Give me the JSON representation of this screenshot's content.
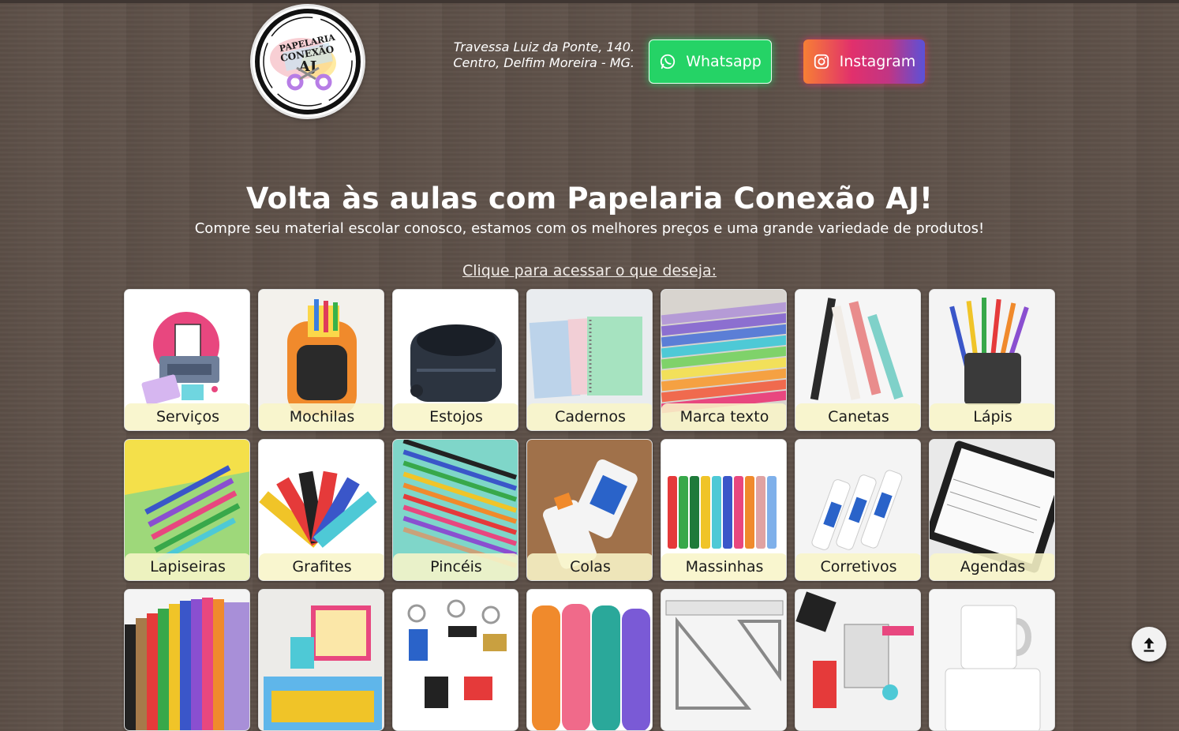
{
  "header": {
    "logo_text": [
      "PAPELARIA",
      "CONEXÃO",
      "AJ"
    ],
    "address_line1": "Travessa Luiz da Ponte, 140.",
    "address_line2": "Centro, Delfim Moreira - MG.",
    "whatsapp_label": "Whatsapp",
    "instagram_label": "Instagram"
  },
  "hero": {
    "title": "Volta às aulas com Papelaria Conexão AJ!",
    "subtitle": "Compre seu material escolar conosco, estamos com os melhores preços e uma grande variedade de produtos!",
    "cta": "Clique para acessar o que deseja:"
  },
  "categories": [
    {
      "label": "Serviços",
      "icon": "printer-icon"
    },
    {
      "label": "Mochilas",
      "icon": "backpack-icon"
    },
    {
      "label": "Estojos",
      "icon": "pencil-case-icon"
    },
    {
      "label": "Cadernos",
      "icon": "notebook-icon"
    },
    {
      "label": "Marca texto",
      "icon": "highlighter-icon"
    },
    {
      "label": "Canetas",
      "icon": "pen-icon"
    },
    {
      "label": "Lápis",
      "icon": "pencil-icon"
    },
    {
      "label": "Lapiseiras",
      "icon": "mechanical-pencil-icon"
    },
    {
      "label": "Grafites",
      "icon": "lead-refill-icon"
    },
    {
      "label": "Pincéis",
      "icon": "marker-icon"
    },
    {
      "label": "Colas",
      "icon": "glue-icon"
    },
    {
      "label": "Massinhas",
      "icon": "clay-icon"
    },
    {
      "label": "Corretivos",
      "icon": "corrector-icon"
    },
    {
      "label": "Agendas",
      "icon": "planner-icon"
    },
    {
      "label": "",
      "icon": "paper-sheets-icon"
    },
    {
      "label": "",
      "icon": "kit-box-icon"
    },
    {
      "label": "",
      "icon": "keychain-icon"
    },
    {
      "label": "",
      "icon": "bottle-icon"
    },
    {
      "label": "",
      "icon": "ruler-icon"
    },
    {
      "label": "",
      "icon": "office-supplies-icon"
    },
    {
      "label": "",
      "icon": "mug-icon"
    }
  ],
  "colors": {
    "background": "#5e5149",
    "whatsapp": "#25d366",
    "instagram_gradient": [
      "#f77f35",
      "#e1306c",
      "#c13584",
      "#5b51d8"
    ],
    "label_bg": "#f8f5c8"
  },
  "scroll_top_icon": "arrow-up-icon"
}
